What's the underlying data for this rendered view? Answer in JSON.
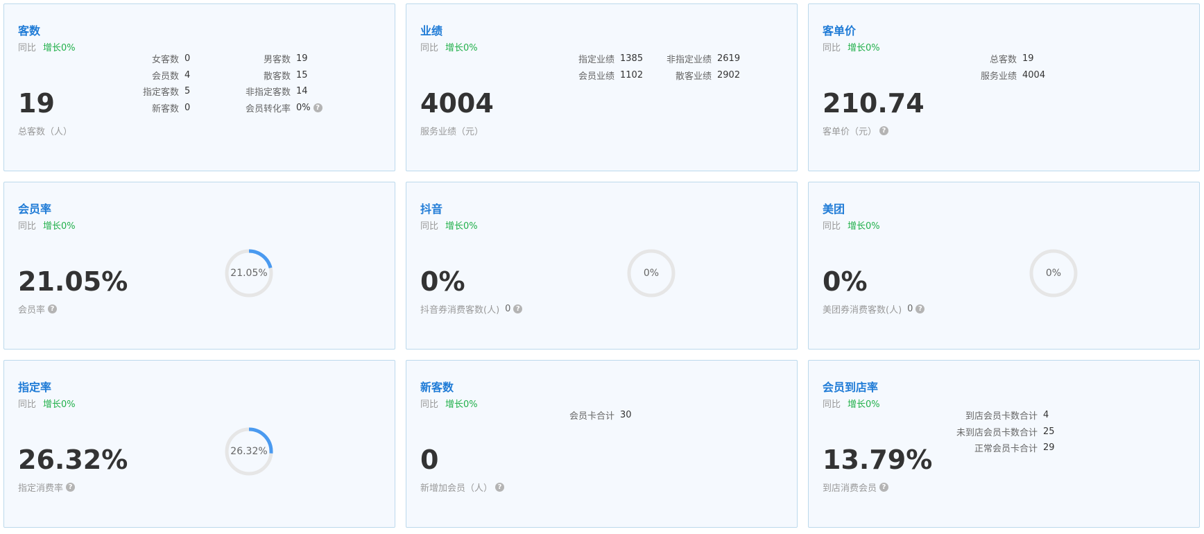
{
  "accent": "#1f7bd6",
  "growth_color": "#21b04a",
  "ring_color": "#4a9af0",
  "cards": {
    "customers": {
      "title": "客数",
      "compare": "同比",
      "growth": "增长0%",
      "value": "19",
      "subtitle": "总客数（人）",
      "stats": {
        "female_label": "女客数",
        "female_value": "0",
        "male_label": "男客数",
        "male_value": "19",
        "member_label": "会员数",
        "member_value": "4",
        "walkin_label": "散客数",
        "walkin_value": "15",
        "designated_label": "指定客数",
        "designated_value": "5",
        "nondesignated_label": "非指定客数",
        "nondesignated_value": "14",
        "new_label": "新客数",
        "new_value": "0",
        "conversion_label": "会员转化率",
        "conversion_value": "0%"
      }
    },
    "performance": {
      "title": "业绩",
      "compare": "同比",
      "growth": "增长0%",
      "value": "4004",
      "subtitle": "服务业绩（元）",
      "stats": {
        "designated_label": "指定业绩",
        "designated_value": "1385",
        "nondesignated_label": "非指定业绩",
        "nondesignated_value": "2619",
        "member_label": "会员业绩",
        "member_value": "1102",
        "walkin_label": "散客业绩",
        "walkin_value": "2902"
      }
    },
    "avg_price": {
      "title": "客单价",
      "compare": "同比",
      "growth": "增长0%",
      "value": "210.74",
      "subtitle": "客单价（元）",
      "stats": {
        "total_label": "总客数",
        "total_value": "19",
        "service_label": "服务业绩",
        "service_value": "4004"
      }
    },
    "member_rate": {
      "title": "会员率",
      "compare": "同比",
      "growth": "增长0%",
      "value": "21.05%",
      "subtitle": "会员率",
      "ring_label": "21.05%",
      "ring_fraction": 0.2105
    },
    "douyin": {
      "title": "抖音",
      "compare": "同比",
      "growth": "增长0%",
      "value": "0%",
      "subtitle": "抖音券消费客数(人)",
      "subtitle_value": "0",
      "ring_label": "0%",
      "ring_fraction": 0
    },
    "meituan": {
      "title": "美团",
      "compare": "同比",
      "growth": "增长0%",
      "value": "0%",
      "subtitle": "美团券消费客数(人)",
      "subtitle_value": "0",
      "ring_label": "0%",
      "ring_fraction": 0
    },
    "designated_rate": {
      "title": "指定率",
      "compare": "同比",
      "growth": "增长0%",
      "value": "26.32%",
      "subtitle": "指定消费率",
      "ring_label": "26.32%",
      "ring_fraction": 0.2632
    },
    "new_customers": {
      "title": "新客数",
      "compare": "同比",
      "growth": "增长0%",
      "value": "0",
      "subtitle": "新增加会员（人）",
      "stats": {
        "card_total_label": "会员卡合计",
        "card_total_value": "30"
      }
    },
    "visit_rate": {
      "title": "会员到店率",
      "compare": "同比",
      "growth": "增长0%",
      "value": "13.79%",
      "subtitle": "到店消费会员",
      "stats": {
        "visited_label": "到店会员卡数合计",
        "visited_value": "4",
        "not_visited_label": "未到店会员卡数合计",
        "not_visited_value": "25",
        "normal_label": "正常会员卡合计",
        "normal_value": "29"
      }
    }
  }
}
